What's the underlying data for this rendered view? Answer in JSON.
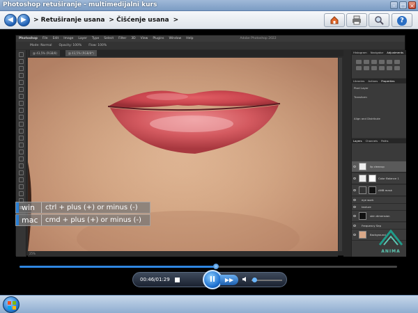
{
  "window": {
    "title": "Photoshop retuširanje - multimedijalni kurs"
  },
  "nav": {
    "breadcrumbs": [
      "> Retuširanje usana",
      "> Čišćenje usana",
      ">"
    ],
    "tool_icons": [
      "home-icon",
      "print-icon",
      "search-icon",
      "help-icon"
    ],
    "help_label": "?"
  },
  "photoshop": {
    "menu": [
      "Photoshop",
      "File",
      "Edit",
      "Image",
      "Layer",
      "Type",
      "Select",
      "Filter",
      "3D",
      "View",
      "Plugins",
      "Window",
      "Help"
    ],
    "window_title": "Adobe Photoshop 2022",
    "options": [
      "Mode: Normal",
      "Opacity: 100%",
      "Flow: 100%"
    ],
    "doc_tabs": [
      "@ 43,5% (RGB/8)",
      "@ 43,5% (RGB/8*)"
    ],
    "status": "25%",
    "panel_tabs_top": [
      "Histogram",
      "Navigator",
      "Adjustments"
    ],
    "panel_tabs_mid": [
      "Libraries",
      "Actions",
      "Properties"
    ],
    "panel_tabs_layers": [
      "Layers",
      "Channels",
      "Paths"
    ],
    "properties_sections": [
      "Pixel Layer",
      "Transform",
      "Align and Distribute"
    ],
    "layers": [
      {
        "name": "lip cleanup",
        "selected": true
      },
      {
        "name": "Color Balance 1",
        "selected": false
      },
      {
        "name": "AMB mask",
        "selected": false
      },
      {
        "name": "eye work",
        "selected": false
      },
      {
        "name": "texture",
        "selected": false
      },
      {
        "name": "skin dimension",
        "selected": false
      },
      {
        "name": "Frequency Sep",
        "selected": false
      },
      {
        "name": "Background",
        "selected": false
      }
    ],
    "watermark": "ANIMA"
  },
  "shortcut_overlay": {
    "rows": [
      {
        "key": "win",
        "text": "ctrl + plus (+) or minus (-)"
      },
      {
        "key": "mac",
        "text": "cmd + plus (+) or minus (-)"
      }
    ],
    "accent_color": "#2a7fd4"
  },
  "player": {
    "time": "00:46/01:29",
    "progress_fraction": 0.52,
    "volume_fraction": 0.1,
    "play_label": "II",
    "ffwd_label": "▶▶",
    "volume_icon": "speaker-icon",
    "accent_color": "#2f86e0"
  },
  "taskbar": {
    "start_icon": "windows-logo"
  }
}
